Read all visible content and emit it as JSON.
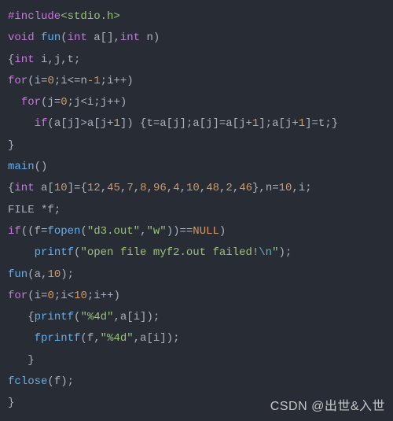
{
  "watermark": "CSDN @出世&入世",
  "code_lines_text": [
    "#include<stdio.h>",
    "void fun(int a[],int n)",
    "{int i,j,t;",
    "for(i=0;i<=n-1;i++)",
    "  for(j=0;j<i;j++)",
    "    if(a[j]>a[j+1]) {t=a[j];a[j]=a[j+1];a[j+1]=t;}",
    "}",
    "main()",
    "{int a[10]={12,45,7,8,96,4,10,48,2,46},n=10,i;",
    "FILE *f;",
    "if((f=fopen(\"d3.out\",\"w\"))==NULL)",
    "    printf(\"open file myf2.out failed!\\n\");",
    "fun(a,10);",
    "for(i=0;i<10;i++)",
    "   {printf(\"%4d\",a[i]);",
    "    fprintf(f,\"%4d\",a[i]);",
    "   }",
    "fclose(f);",
    "}"
  ],
  "code_lines": [
    [
      {
        "t": "#include",
        "c": "meta"
      },
      {
        "t": "<stdio.h>",
        "c": "metastr"
      }
    ],
    [
      {
        "t": "void",
        "c": "type"
      },
      {
        "t": " ",
        "c": "punct"
      },
      {
        "t": "fun",
        "c": "func"
      },
      {
        "t": "(",
        "c": "punct"
      },
      {
        "t": "int",
        "c": "type"
      },
      {
        "t": " a[],",
        "c": "punct"
      },
      {
        "t": "int",
        "c": "type"
      },
      {
        "t": " n)",
        "c": "punct"
      }
    ],
    [
      {
        "t": "{",
        "c": "punct"
      },
      {
        "t": "int",
        "c": "type"
      },
      {
        "t": " i,j,t;",
        "c": "punct"
      }
    ],
    [
      {
        "t": "for",
        "c": "keyword"
      },
      {
        "t": "(i=",
        "c": "punct"
      },
      {
        "t": "0",
        "c": "number"
      },
      {
        "t": ";i<=n",
        "c": "punct"
      },
      {
        "t": "-1",
        "c": "number"
      },
      {
        "t": ";i++)",
        "c": "punct"
      }
    ],
    [
      {
        "t": "  ",
        "c": "punct"
      },
      {
        "t": "for",
        "c": "keyword"
      },
      {
        "t": "(j=",
        "c": "punct"
      },
      {
        "t": "0",
        "c": "number"
      },
      {
        "t": ";j<i;j++)",
        "c": "punct"
      }
    ],
    [
      {
        "t": "    ",
        "c": "punct"
      },
      {
        "t": "if",
        "c": "keyword"
      },
      {
        "t": "(a[j]>a[j+",
        "c": "punct"
      },
      {
        "t": "1",
        "c": "number"
      },
      {
        "t": "]) {t=a[j];a[j]=a[j+",
        "c": "punct"
      },
      {
        "t": "1",
        "c": "number"
      },
      {
        "t": "];a[j+",
        "c": "punct"
      },
      {
        "t": "1",
        "c": "number"
      },
      {
        "t": "]=t;}",
        "c": "punct"
      }
    ],
    [
      {
        "t": "}",
        "c": "punct"
      }
    ],
    [
      {
        "t": "main",
        "c": "func"
      },
      {
        "t": "()",
        "c": "punct"
      }
    ],
    [
      {
        "t": "{",
        "c": "punct"
      },
      {
        "t": "int",
        "c": "type"
      },
      {
        "t": " a[",
        "c": "punct"
      },
      {
        "t": "10",
        "c": "number"
      },
      {
        "t": "]={",
        "c": "punct"
      },
      {
        "t": "12",
        "c": "number"
      },
      {
        "t": ",",
        "c": "punct"
      },
      {
        "t": "45",
        "c": "number"
      },
      {
        "t": ",",
        "c": "punct"
      },
      {
        "t": "7",
        "c": "number"
      },
      {
        "t": ",",
        "c": "punct"
      },
      {
        "t": "8",
        "c": "number"
      },
      {
        "t": ",",
        "c": "punct"
      },
      {
        "t": "96",
        "c": "number"
      },
      {
        "t": ",",
        "c": "punct"
      },
      {
        "t": "4",
        "c": "number"
      },
      {
        "t": ",",
        "c": "punct"
      },
      {
        "t": "10",
        "c": "number"
      },
      {
        "t": ",",
        "c": "punct"
      },
      {
        "t": "48",
        "c": "number"
      },
      {
        "t": ",",
        "c": "punct"
      },
      {
        "t": "2",
        "c": "number"
      },
      {
        "t": ",",
        "c": "punct"
      },
      {
        "t": "46",
        "c": "number"
      },
      {
        "t": "},n=",
        "c": "punct"
      },
      {
        "t": "10",
        "c": "number"
      },
      {
        "t": ",i;",
        "c": "punct"
      }
    ],
    [
      {
        "t": "FILE *f;",
        "c": "punct"
      }
    ],
    [
      {
        "t": "if",
        "c": "keyword"
      },
      {
        "t": "((f=",
        "c": "punct"
      },
      {
        "t": "fopen",
        "c": "func"
      },
      {
        "t": "(",
        "c": "punct"
      },
      {
        "t": "\"d3.out\"",
        "c": "string"
      },
      {
        "t": ",",
        "c": "punct"
      },
      {
        "t": "\"w\"",
        "c": "string"
      },
      {
        "t": "))==",
        "c": "punct"
      },
      {
        "t": "NULL",
        "c": "const"
      },
      {
        "t": ")",
        "c": "punct"
      }
    ],
    [
      {
        "t": "    ",
        "c": "punct"
      },
      {
        "t": "printf",
        "c": "func"
      },
      {
        "t": "(",
        "c": "punct"
      },
      {
        "t": "\"open file myf2.out failed!",
        "c": "string"
      },
      {
        "t": "\\n",
        "c": "escape"
      },
      {
        "t": "\"",
        "c": "string"
      },
      {
        "t": ");",
        "c": "punct"
      }
    ],
    [
      {
        "t": "fun",
        "c": "func"
      },
      {
        "t": "(a,",
        "c": "punct"
      },
      {
        "t": "10",
        "c": "number"
      },
      {
        "t": ");",
        "c": "punct"
      }
    ],
    [
      {
        "t": "for",
        "c": "keyword"
      },
      {
        "t": "(i=",
        "c": "punct"
      },
      {
        "t": "0",
        "c": "number"
      },
      {
        "t": ";i<",
        "c": "punct"
      },
      {
        "t": "10",
        "c": "number"
      },
      {
        "t": ";i++)",
        "c": "punct"
      }
    ],
    [
      {
        "t": "   {",
        "c": "punct"
      },
      {
        "t": "printf",
        "c": "func"
      },
      {
        "t": "(",
        "c": "punct"
      },
      {
        "t": "\"%4d\"",
        "c": "string"
      },
      {
        "t": ",a[i]);",
        "c": "punct"
      }
    ],
    [
      {
        "t": "    ",
        "c": "punct"
      },
      {
        "t": "fprintf",
        "c": "func"
      },
      {
        "t": "(f,",
        "c": "punct"
      },
      {
        "t": "\"%4d\"",
        "c": "string"
      },
      {
        "t": ",a[i]);",
        "c": "punct"
      }
    ],
    [
      {
        "t": "   }",
        "c": "punct"
      }
    ],
    [
      {
        "t": "fclose",
        "c": "func"
      },
      {
        "t": "(f);",
        "c": "punct"
      }
    ],
    [
      {
        "t": "}",
        "c": "punct"
      }
    ]
  ]
}
